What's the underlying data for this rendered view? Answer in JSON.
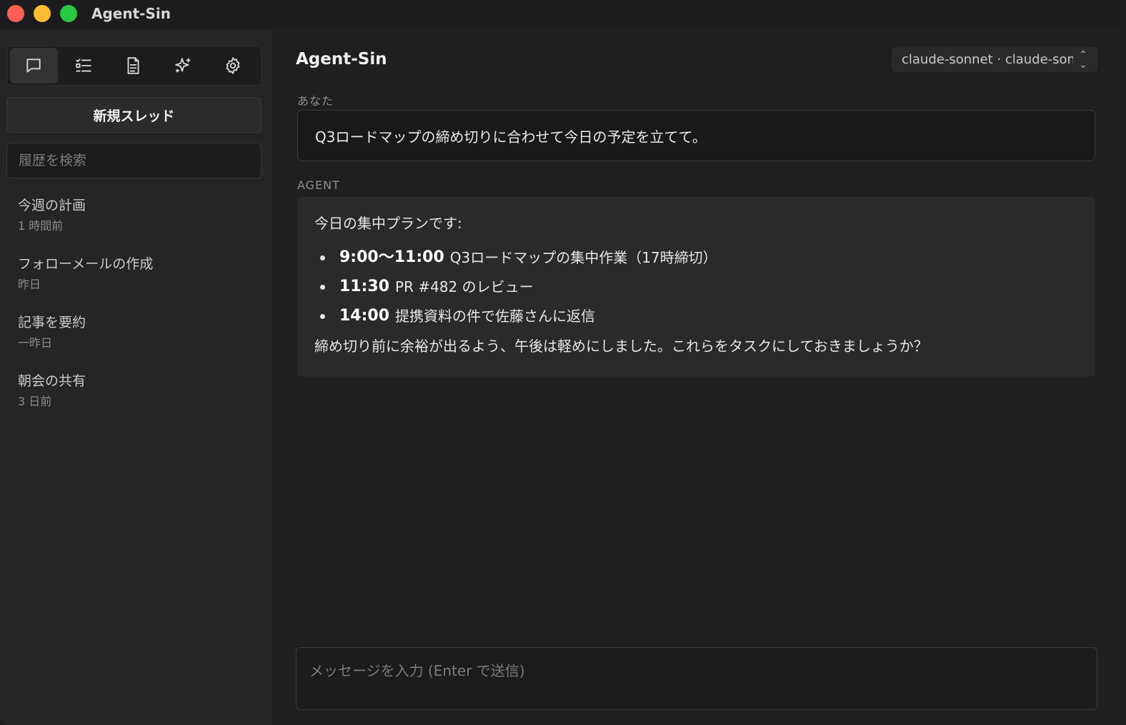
{
  "window": {
    "title": "Agent-Sin"
  },
  "sidebar": {
    "tabs": [
      {
        "name": "chat",
        "icon": "chat-bubble-icon",
        "active": true
      },
      {
        "name": "tasks",
        "icon": "checklist-icon",
        "active": false
      },
      {
        "name": "documents",
        "icon": "document-icon",
        "active": false
      },
      {
        "name": "skills",
        "icon": "sparkle-icon",
        "active": false
      },
      {
        "name": "settings",
        "icon": "gear-icon",
        "active": false
      }
    ],
    "new_thread_label": "新規スレッド",
    "search_placeholder": "履歴を検索",
    "history": [
      {
        "title": "今週の計画",
        "time": "1 時間前"
      },
      {
        "title": "フォローメールの作成",
        "time": "昨日"
      },
      {
        "title": "記事を要約",
        "time": "一昨日"
      },
      {
        "title": "朝会の共有",
        "time": "3 日前"
      }
    ]
  },
  "main": {
    "title": "Agent-Sin",
    "model_selector": {
      "value": "claude-sonnet · claude-sonnet"
    },
    "messages": {
      "user": {
        "role_label": "あなた",
        "text": "Q3ロードマップの締め切りに合わせて今日の予定を立てて。"
      },
      "agent": {
        "role_label": "AGENT",
        "intro": "今日の集中プランです:",
        "items": [
          {
            "time": "9:00〜11:00",
            "text": "Q3ロードマップの集中作業（17時締切）"
          },
          {
            "time": "11:30",
            "text": "PR #482 のレビュー"
          },
          {
            "time": "14:00",
            "text": "提携資料の件で佐藤さんに返信"
          }
        ],
        "outro": "締め切り前に余裕が出るよう、午後は軽めにしました。これらをタスクにしておきましょうか？"
      }
    },
    "composer": {
      "placeholder": "メッセージを入力 (Enter で送信)",
      "value": ""
    }
  },
  "colors": {
    "background": "#1f1f21",
    "sidebar": "#252527",
    "agent_bubble": "#2a2a2d",
    "close": "#ff5f57",
    "minimize": "#febc2e",
    "maximize": "#28c840"
  }
}
